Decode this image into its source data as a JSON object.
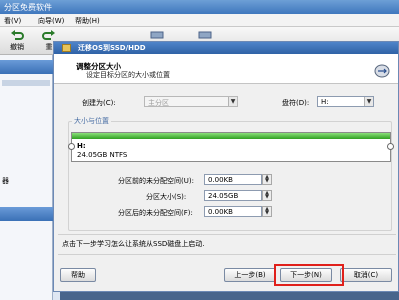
{
  "app": {
    "title": "分区免费软件",
    "menu": [
      "看(V)",
      "向导(W)",
      "帮助(H)"
    ],
    "toolbar": {
      "undo_label": "撤销",
      "next_label": "重"
    }
  },
  "sidebar": {
    "visible_label": "器"
  },
  "dialog": {
    "title": "迁移OS到SSD/HDD",
    "header_title": "调整分区大小",
    "header_subtitle": "设定目标分区的大小或位置",
    "create_as_label": "创建为(C):",
    "create_as_value": "主分区",
    "drive_letter_label": "盘符(D):",
    "drive_letter_value": "H:",
    "group_label": "大小与位置",
    "partition": {
      "name": "H:",
      "info": "24.05GB NTFS",
      "used_fraction": 1.0
    },
    "fields": [
      {
        "label": "分区前的未分配空间(U):",
        "value": "0.00KB"
      },
      {
        "label": "分区大小(S):",
        "value": "24.05GB"
      },
      {
        "label": "分区后的未分配空间(F):",
        "value": "0.00KB"
      }
    ],
    "hint": "点击下一步学习怎么让系统从SSD磁盘上启动.",
    "buttons": {
      "help": "帮助",
      "back": "上一步(B)",
      "next": "下一步(N)",
      "cancel": "取消(C)"
    }
  },
  "colors": {
    "accent": "#2f62a6",
    "bar_green": "#2f9f21",
    "highlight_red": "#e0201b"
  }
}
